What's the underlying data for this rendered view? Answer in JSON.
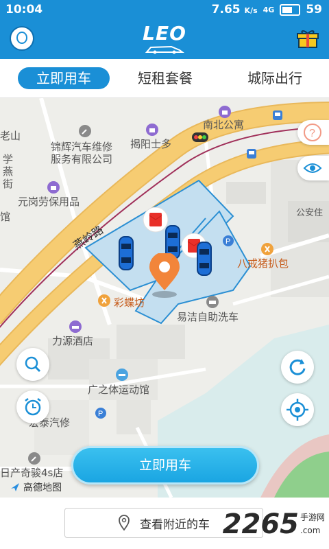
{
  "status_bar": {
    "time": "10:04",
    "speed": "7.65",
    "speed_unit": "K/s",
    "signal": "4G",
    "battery": "59"
  },
  "header": {
    "logo_text": "LEO"
  },
  "tabs": [
    {
      "label": "立即用车",
      "active": true
    },
    {
      "label": "短租套餐",
      "active": false
    },
    {
      "label": "城际出行",
      "active": false
    }
  ],
  "map": {
    "road_label": "燕岭路",
    "pois": {
      "nanbei": "南北公寓",
      "jiexiang": "揭阳士多",
      "jinhui_1": "锦辉汽车维修",
      "jinhui_2": "服务有限公司",
      "yuangang": "元岗劳保用品",
      "xue": "学",
      "yan": "燕",
      "jie": "街",
      "lao_shan": "老山",
      "guan": "馆",
      "bajie": "八戒猪扒包",
      "gongan": "公安住",
      "caidie": "彩蝶坊",
      "yijie": "易洁自助洗车",
      "liyuan": "力源酒店",
      "guangzhiti": "广之体运动馆",
      "hongtai": "宏泰汽修",
      "richan": "日产奇骏4s店"
    },
    "provider": "高德地图"
  },
  "primary_button": "立即用车",
  "nearby_button": "查看附近的车",
  "watermark": {
    "number": "2265",
    "suffix": ".com",
    "text": "手游网"
  },
  "colors": {
    "brand": "#1a8fd6",
    "cta": "#26b2ea"
  }
}
